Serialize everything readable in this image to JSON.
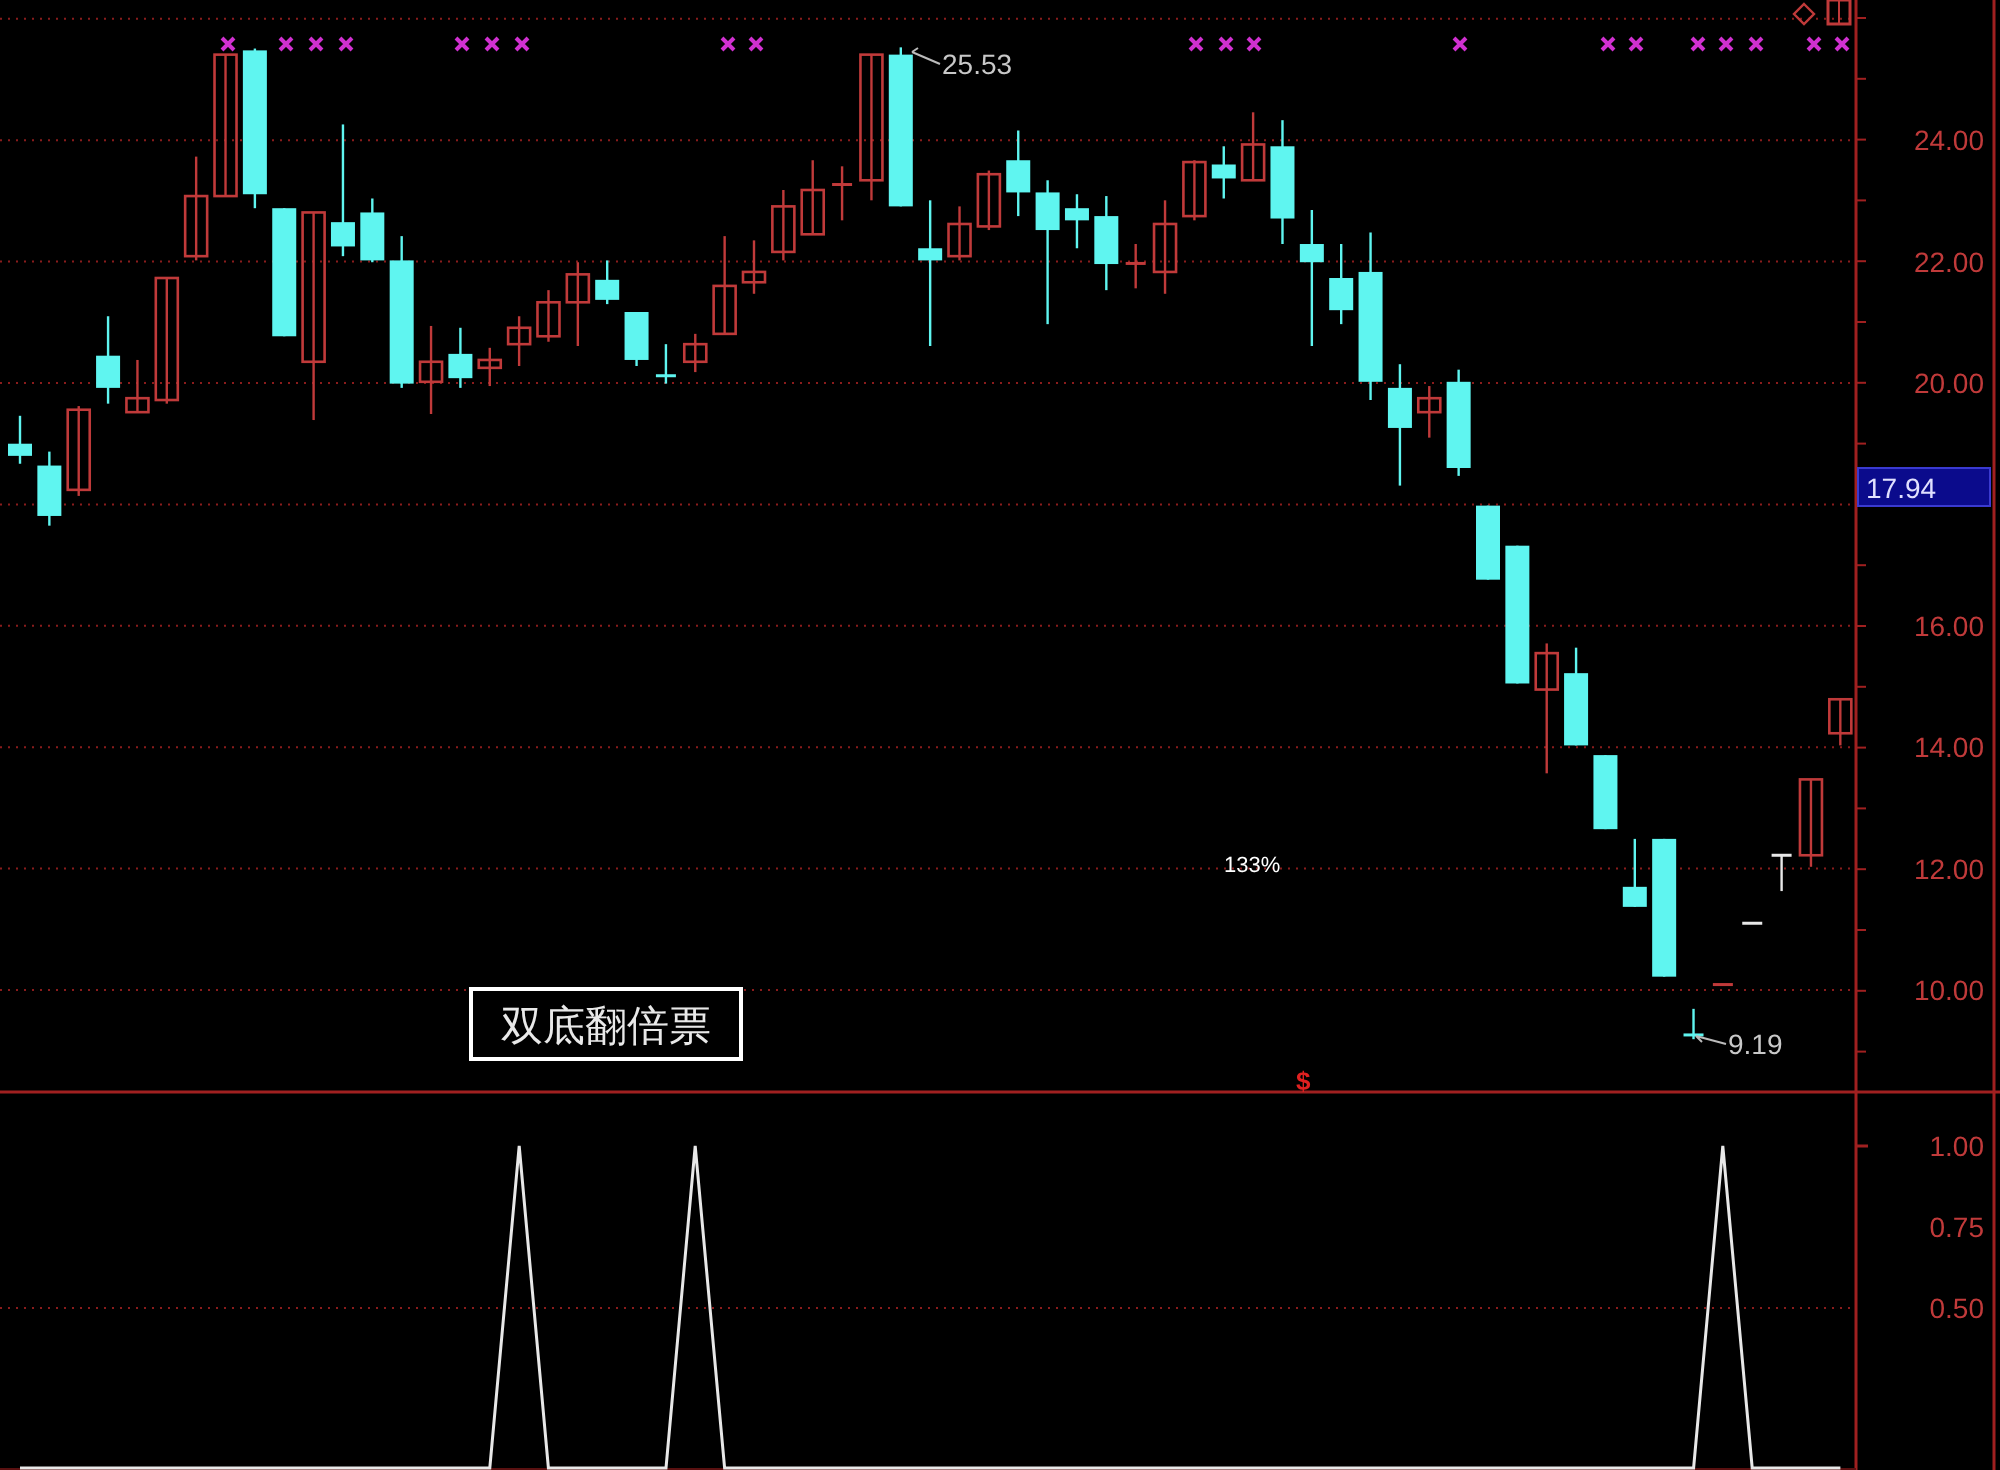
{
  "price_panel": {
    "chart_data": {
      "type": "candlestick",
      "grid": true,
      "ylim": [
        8.32,
        26.31
      ],
      "yticks": [
        {
          "value": 24,
          "label": "24.00"
        },
        {
          "value": 22,
          "label": "22.00"
        },
        {
          "value": 20,
          "label": "20.00"
        },
        {
          "value": 16,
          "label": "16.00"
        },
        {
          "value": 14,
          "label": "14.00"
        },
        {
          "value": 12,
          "label": "12.00"
        },
        {
          "value": 10,
          "label": "10.00"
        }
      ],
      "ohlc": [
        [
          19.0,
          19.46,
          18.67,
          18.8
        ],
        [
          18.64,
          18.87,
          17.65,
          17.81
        ],
        [
          18.24,
          19.62,
          18.14,
          19.56
        ],
        [
          20.45,
          21.1,
          19.66,
          19.92
        ],
        [
          19.52,
          20.38,
          19.52,
          19.75
        ],
        [
          19.72,
          21.73,
          19.66,
          21.73
        ],
        [
          22.09,
          23.73,
          22.02,
          23.08
        ],
        [
          23.08,
          25.41,
          23.08,
          25.41
        ],
        [
          25.48,
          25.51,
          22.88,
          23.11
        ],
        [
          22.88,
          22.88,
          20.77,
          20.77
        ],
        [
          20.35,
          22.81,
          19.39,
          22.81
        ],
        [
          22.65,
          24.26,
          22.09,
          22.25
        ],
        [
          22.81,
          23.04,
          21.99,
          22.02
        ],
        [
          22.02,
          22.42,
          19.92,
          19.99
        ],
        [
          20.02,
          20.94,
          19.49,
          20.35
        ],
        [
          20.48,
          20.91,
          19.92,
          20.08
        ],
        [
          20.25,
          20.58,
          19.95,
          20.38
        ],
        [
          20.64,
          21.1,
          20.28,
          20.91
        ],
        [
          20.77,
          21.53,
          20.68,
          21.33
        ],
        [
          21.33,
          21.99,
          20.61,
          21.79
        ],
        [
          21.7,
          22.02,
          21.3,
          21.37
        ],
        [
          21.17,
          21.17,
          20.28,
          20.38
        ],
        [
          20.12,
          20.64,
          19.99,
          20.12
        ],
        [
          20.35,
          20.81,
          20.18,
          20.64
        ],
        [
          20.81,
          22.42,
          20.81,
          21.6
        ],
        [
          21.66,
          22.35,
          21.47,
          21.83
        ],
        [
          22.16,
          23.18,
          22.02,
          22.91
        ],
        [
          22.45,
          23.67,
          22.45,
          23.18
        ],
        [
          23.27,
          23.57,
          22.68,
          23.27
        ],
        [
          23.34,
          25.41,
          23.01,
          25.41
        ],
        [
          25.41,
          25.53,
          22.91,
          22.91
        ],
        [
          22.22,
          23.01,
          20.61,
          22.02
        ],
        [
          22.09,
          22.91,
          22.02,
          22.62
        ],
        [
          22.58,
          23.5,
          22.52,
          23.44
        ],
        [
          23.67,
          24.16,
          22.75,
          23.14
        ],
        [
          23.14,
          23.34,
          20.97,
          22.52
        ],
        [
          22.88,
          23.11,
          22.22,
          22.68
        ],
        [
          22.75,
          23.08,
          21.53,
          21.96
        ],
        [
          21.97,
          22.29,
          21.56,
          21.97
        ],
        [
          21.83,
          23.01,
          21.47,
          22.62
        ],
        [
          22.75,
          23.67,
          22.68,
          23.64
        ],
        [
          23.6,
          23.9,
          23.04,
          23.37
        ],
        [
          23.34,
          24.46,
          23.34,
          23.93
        ],
        [
          23.9,
          24.33,
          22.29,
          22.71
        ],
        [
          22.29,
          22.85,
          20.61,
          21.99
        ],
        [
          21.73,
          22.29,
          20.97,
          21.2
        ],
        [
          21.83,
          22.48,
          19.72,
          20.02
        ],
        [
          19.92,
          20.31,
          18.31,
          19.26
        ],
        [
          19.52,
          19.95,
          19.1,
          19.75
        ],
        [
          20.02,
          20.22,
          18.47,
          18.6
        ],
        [
          17.98,
          17.98,
          16.76,
          16.76
        ],
        [
          17.32,
          17.32,
          15.05,
          15.05
        ],
        [
          14.95,
          15.71,
          13.57,
          15.55
        ],
        [
          15.22,
          15.64,
          14.03,
          14.03
        ],
        [
          13.87,
          13.87,
          12.65,
          12.65
        ],
        [
          11.7,
          12.49,
          11.37,
          11.37
        ],
        [
          12.49,
          12.49,
          10.22,
          10.22
        ],
        [
          9.26,
          9.69,
          9.19,
          9.26
        ],
        [
          10.09,
          10.09,
          10.09,
          10.09
        ],
        [
          11.1,
          11.1,
          11.1,
          11.1
        ],
        [
          12.22,
          12.22,
          11.63,
          12.22
        ],
        [
          12.22,
          13.47,
          12.03,
          13.47
        ],
        [
          14.23,
          14.79,
          14.03,
          14.79
        ]
      ]
    }
  },
  "current_price": "17.94",
  "annotations": {
    "high_label": "25.53",
    "low_label": "9.19",
    "percent": "133%",
    "signal_marker": "$"
  },
  "indicator_title": "双底翻倍票",
  "indicator_panel": {
    "chart_data": {
      "type": "line",
      "ylim": [
        0,
        1
      ],
      "yticks": [
        {
          "value": 1,
          "label": "1.00"
        },
        {
          "value": 0.75,
          "label": "0.75"
        },
        {
          "value": 0.5,
          "label": "0.50"
        }
      ],
      "series": [
        {
          "color": "#e8e8e8",
          "values": [
            0,
            0,
            0,
            0,
            0,
            0,
            0,
            0,
            0,
            0,
            0,
            0,
            0,
            0,
            0,
            0,
            0,
            1,
            0,
            0,
            0,
            0,
            0,
            1,
            0,
            0,
            0,
            0,
            0,
            0,
            0,
            0,
            0,
            0,
            0,
            0,
            0,
            0,
            0,
            0,
            0,
            0,
            0,
            0,
            0,
            0,
            0,
            0,
            0,
            0,
            0,
            0,
            0,
            0,
            0,
            0,
            0,
            0,
            1,
            0,
            0,
            0,
            0
          ]
        }
      ]
    }
  }
}
